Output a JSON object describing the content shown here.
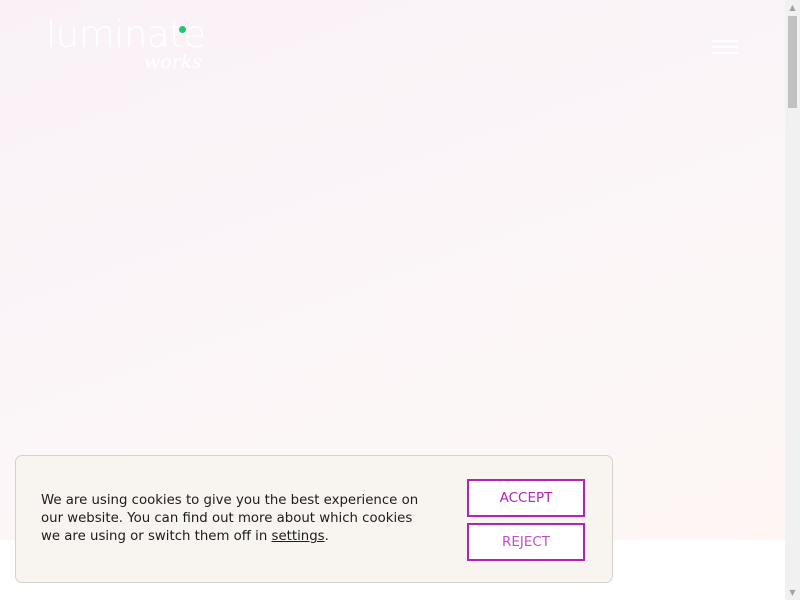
{
  "header": {
    "logo_main": "luminate",
    "logo_sub": "works",
    "menu_icon": "hamburger-menu-icon"
  },
  "cookie_banner": {
    "text_before_link": "We are using cookies to give you the best experience on our website. You can find out more about which cookies we are using or switch them off in ",
    "settings_link": "settings",
    "text_after_link": ".",
    "accept_label": "ACCEPT",
    "reject_label": "REJECT"
  },
  "colors": {
    "accent": "#b223b9",
    "logo_dot": "#1ec96b",
    "banner_bg": "#f8f4ef"
  },
  "scrollbar": {
    "up_icon": "scroll-up-arrow-icon",
    "down_icon": "scroll-down-arrow-icon"
  }
}
